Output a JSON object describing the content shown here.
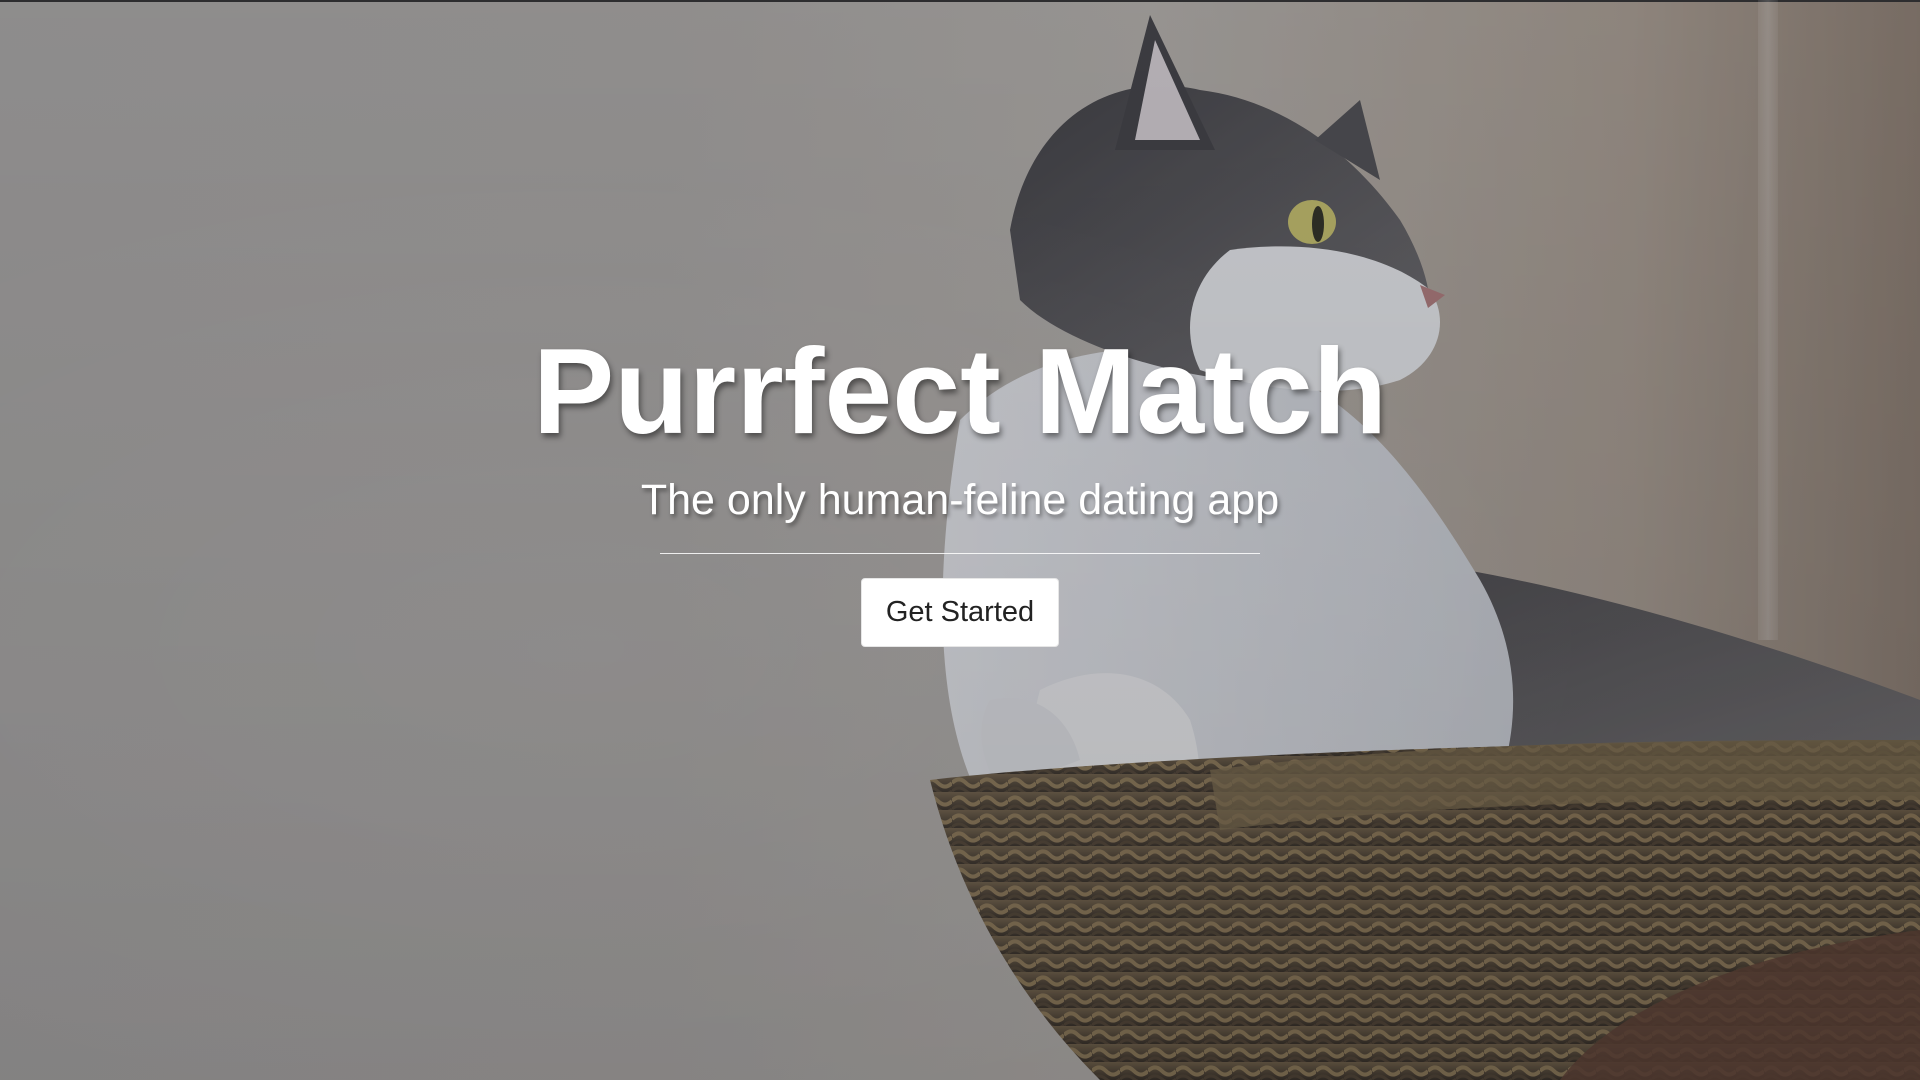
{
  "hero": {
    "title": "Purrfect Match",
    "subtitle": "The only human-feline dating app",
    "cta_label": "Get Started",
    "background_image": "cat-in-basket-photo"
  },
  "colors": {
    "text": "#ffffff",
    "button_bg": "#ffffff",
    "button_text": "#222222",
    "overlay": "#3c3c46"
  }
}
